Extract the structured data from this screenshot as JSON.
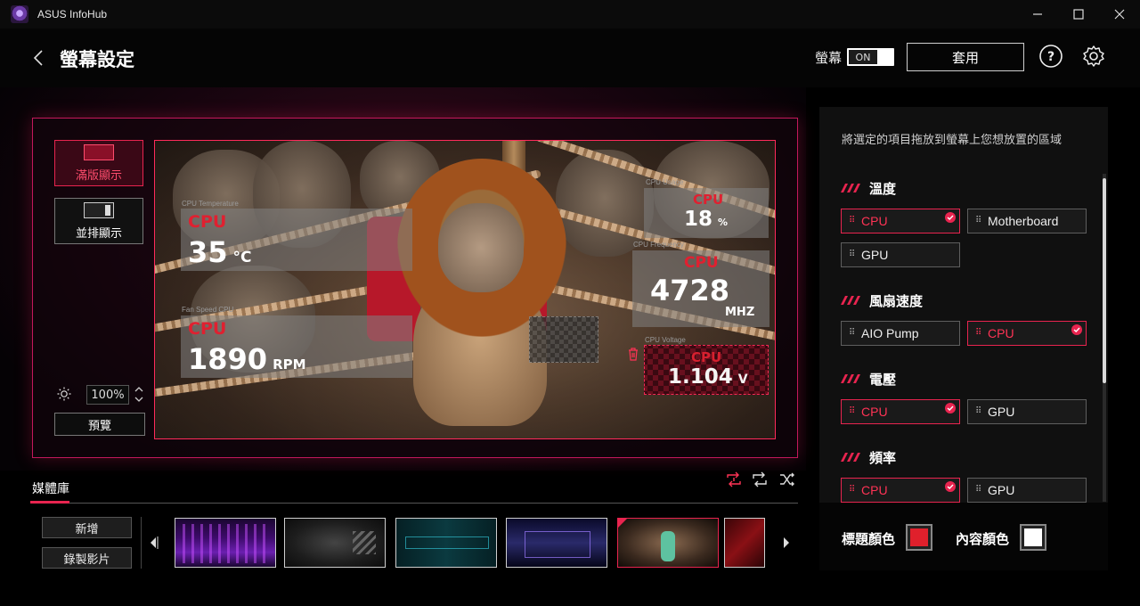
{
  "window": {
    "title": "ASUS InfoHub",
    "logo_icon": "asus-rog-logo-icon"
  },
  "header": {
    "page_title": "螢幕設定",
    "screen_toggle_label": "螢幕",
    "screen_toggle_state": "ON",
    "apply_label": "套用"
  },
  "layout_modes": [
    {
      "label": "滿版顯示",
      "selected": true
    },
    {
      "label": "並排顯示",
      "selected": false
    }
  ],
  "brightness": {
    "value": "100%"
  },
  "preview_label": "預覽",
  "widgets": {
    "cpu_temp": {
      "caption": "CPU Temperature",
      "label": "CPU",
      "value": "35",
      "unit": "°C"
    },
    "fan_speed": {
      "caption": "Fan Speed CPU",
      "label": "CPU",
      "value": "1890",
      "unit": "RPM"
    },
    "cpu_usage": {
      "caption": "CPU Usage",
      "label": "CPU",
      "value": "18",
      "unit": "%"
    },
    "cpu_freq": {
      "caption": "CPU Frequency",
      "label": "CPU",
      "value": "4728",
      "unit": "MHZ"
    },
    "cpu_voltage": {
      "caption": "CPU Voltage",
      "label": "CPU",
      "value": "1.104",
      "unit": "V"
    }
  },
  "media": {
    "tab_label": "媒體庫",
    "add_label": "新增",
    "record_label": "錄製影片",
    "thumbnails": [
      {
        "name": "purple-city",
        "active": false
      },
      {
        "name": "dark-smoke",
        "active": false
      },
      {
        "name": "cyan-tech",
        "active": false
      },
      {
        "name": "neon-corridor",
        "active": false
      },
      {
        "name": "boxing-cat",
        "active": true
      },
      {
        "name": "red-mech",
        "active": false
      }
    ]
  },
  "panel": {
    "instruction": "將選定的項目拖放到螢幕上您想放置的區域",
    "sections": [
      {
        "title": "溫度",
        "items": [
          {
            "label": "CPU",
            "on": true
          },
          {
            "label": "Motherboard",
            "on": false
          },
          {
            "label": "GPU",
            "on": false
          }
        ]
      },
      {
        "title": "風扇速度",
        "items": [
          {
            "label": "AIO Pump",
            "on": false
          },
          {
            "label": "CPU",
            "on": true
          }
        ]
      },
      {
        "title": "電壓",
        "items": [
          {
            "label": "CPU",
            "on": true
          },
          {
            "label": "GPU",
            "on": false
          }
        ]
      },
      {
        "title": "頻率",
        "items": [
          {
            "label": "CPU",
            "on": true
          },
          {
            "label": "GPU",
            "on": false
          }
        ]
      }
    ],
    "title_color_label": "標題顏色",
    "content_color_label": "內容顏色",
    "title_color": "#e0202c",
    "content_color": "#ffffff"
  },
  "colors": {
    "accent": "#e8244f",
    "widget_label": "#e02030"
  }
}
